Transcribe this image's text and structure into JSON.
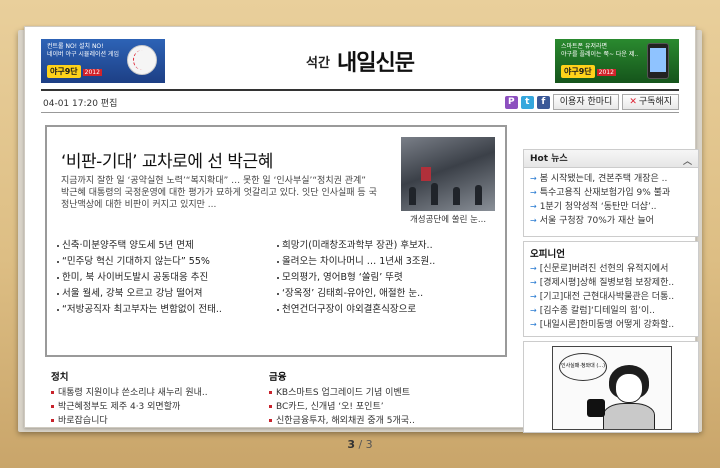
{
  "ads": {
    "left": {
      "line1": "컨트롤 NO! 설치 NO!",
      "line2": "네이버 야구 시뮬레이션 게임",
      "brand": "야구9단",
      "year": "2012"
    },
    "right": {
      "line1": "스마트폰 유저라면",
      "line2": "야구를 플레이는 쭉~ 다운 제..",
      "brand": "야구9단",
      "year": "2012"
    }
  },
  "masthead": {
    "sub": "석간",
    "name": "내일신문"
  },
  "toolbar": {
    "date": "04-01 17:20 편집",
    "p_icon": "P",
    "t_icon": "t",
    "f_icon": "f",
    "comment_button": "이용자 한마디",
    "subscribe_button": "구독해지"
  },
  "lead": {
    "title": "‘비판-기대’ 교차로에 선 박근혜",
    "summary_1": "지금까지 잘한 일 ‘공약실현 노력’“복지확대” … 못한 일 ‘인사부실’“정치권 관계”",
    "summary_2": "박근혜 대통령의 국정운영에 대한 평가가 묘하게 엇갈리고 있다. 잇단 인사실패 등 국정난맥상에 대한 비판이 커지고 있지만 ...",
    "photo_caption": "개성공단에 쏠린 눈...",
    "headlines": [
      "신축·미분양주택 양도세 5년 면제",
      "희망기(미래창조과학부 장관) 후보자..",
      "“민주당 혁신 기대하지 않는다” 55%",
      "올려오는 차이나머니 … 1년새 3조원..",
      "한미, 북 사이버도발시 공동대응 추진",
      "모의평가, 영어B형 ‘쏠림’ 뚜렷",
      "서울 월세, 강북 오르고 강남 떨어져",
      "‘장옥정’ 김태희-유아인, 애절한 눈..",
      "“저방공직자 최고부자는 변함없이 전태..",
      "천연건더구장이 야외결혼식장으로"
    ]
  },
  "politics": {
    "title": "정치",
    "items": [
      "대통령 지원이냐 쓴소리냐 새누리 원내..",
      "박근혜정부도 제주 4·3 외면할까",
      "바로잡습니다"
    ]
  },
  "finance": {
    "title": "금융",
    "items": [
      "KB스마트S 업그레이드 기념 이벤트",
      "BC카드, 신개념 ‘오! 포인트’",
      "신한금융투자, 해외채권 중개 5개국.."
    ]
  },
  "hot_news": {
    "title": "Hot 뉴스",
    "items": [
      "봄 시작됐는데, 견본주택 개장은 ..",
      "특수고용직 산재보험가입 9% 불과",
      "1분기 청약성적 ‘동탄만 더샵’..",
      "서울 구청장 70%가 재산 늘어"
    ]
  },
  "opinion": {
    "title": "오피니언",
    "items": [
      "[신문로]버려진 선현의 유적지에서",
      "[경제시평]상해 질병보험 보장제한..",
      "[기고]대전 근현대사박물관은 더통..",
      "[김수종 칼럼]‘디테일의 힘’이..",
      "[내일시론]한미동맹 어떻게 강화할.."
    ]
  },
  "cartoon": {
    "bubble": "인사실패·청와대 (...)"
  },
  "pager": {
    "current": "3",
    "separator": " / ",
    "total": "3"
  }
}
